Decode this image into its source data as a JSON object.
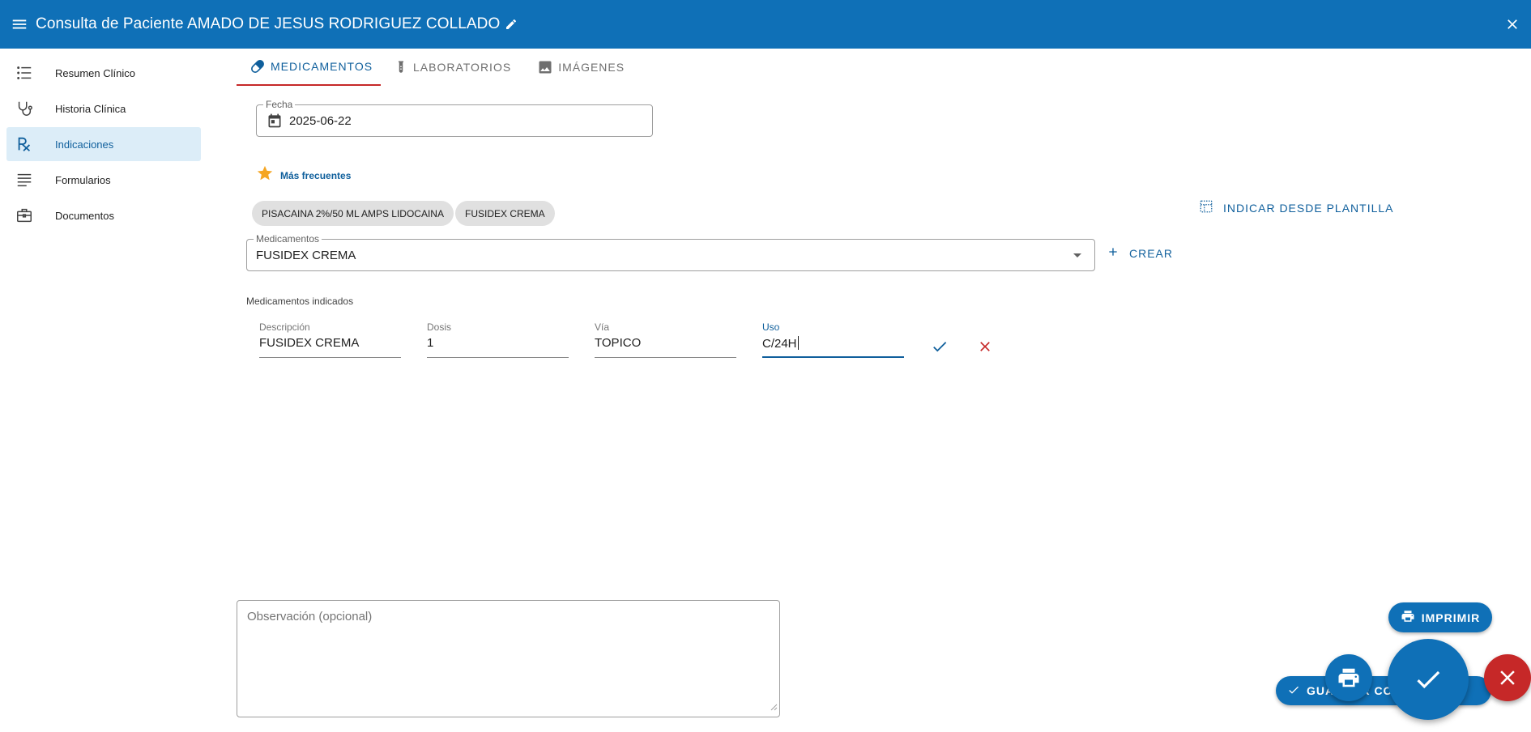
{
  "header": {
    "title": "Consulta de Paciente AMADO DE JESUS RODRIGUEZ COLLADO",
    "bg_color": "#0f70b7"
  },
  "sidebar": {
    "items": [
      {
        "label": "Resumen Clínico",
        "icon": "list-icon"
      },
      {
        "label": "Historia Clínica",
        "icon": "stethoscope-icon"
      },
      {
        "label": "Indicaciones",
        "icon": "prescription-icon",
        "active": true
      },
      {
        "label": "Formularios",
        "icon": "text-lines-icon"
      },
      {
        "label": "Documentos",
        "icon": "briefcase-icon"
      }
    ]
  },
  "tabs": [
    {
      "label": "MEDICAMENTOS",
      "icon": "pill-icon",
      "active": true
    },
    {
      "label": "LABORATORIOS",
      "icon": "test-tube-icon"
    },
    {
      "label": "IMÁGENES",
      "icon": "image-icon"
    }
  ],
  "form": {
    "fecha": {
      "label": "Fecha",
      "value": "2025-06-22"
    },
    "frequent_label": "Más frecuentes",
    "chips": [
      "PISACAINA 2%/50 ML AMPS LIDOCAINA",
      "FUSIDEX CREMA"
    ],
    "template_button": "INDICAR DESDE PLANTILLA",
    "medicamentos": {
      "label": "Medicamentos",
      "value": "FUSIDEX CREMA"
    },
    "create_button": "CREAR",
    "indicated_title": "Medicamentos indicados",
    "row": {
      "descripcion": {
        "label": "Descripción",
        "value": "FUSIDEX CREMA"
      },
      "dosis": {
        "label": "Dosis",
        "value": "1"
      },
      "via": {
        "label": "Vía",
        "value": "TOPICO"
      },
      "uso": {
        "label": "Uso",
        "value": "C/24H"
      }
    },
    "observacion_placeholder": "Observación (opcional)"
  },
  "actions": {
    "print_label": "IMPRIMIR",
    "save_label": "GUARDAR CONSULTA"
  },
  "colors": {
    "primary": "#0f70b7",
    "danger": "#c62828",
    "star": "#f5a623"
  }
}
